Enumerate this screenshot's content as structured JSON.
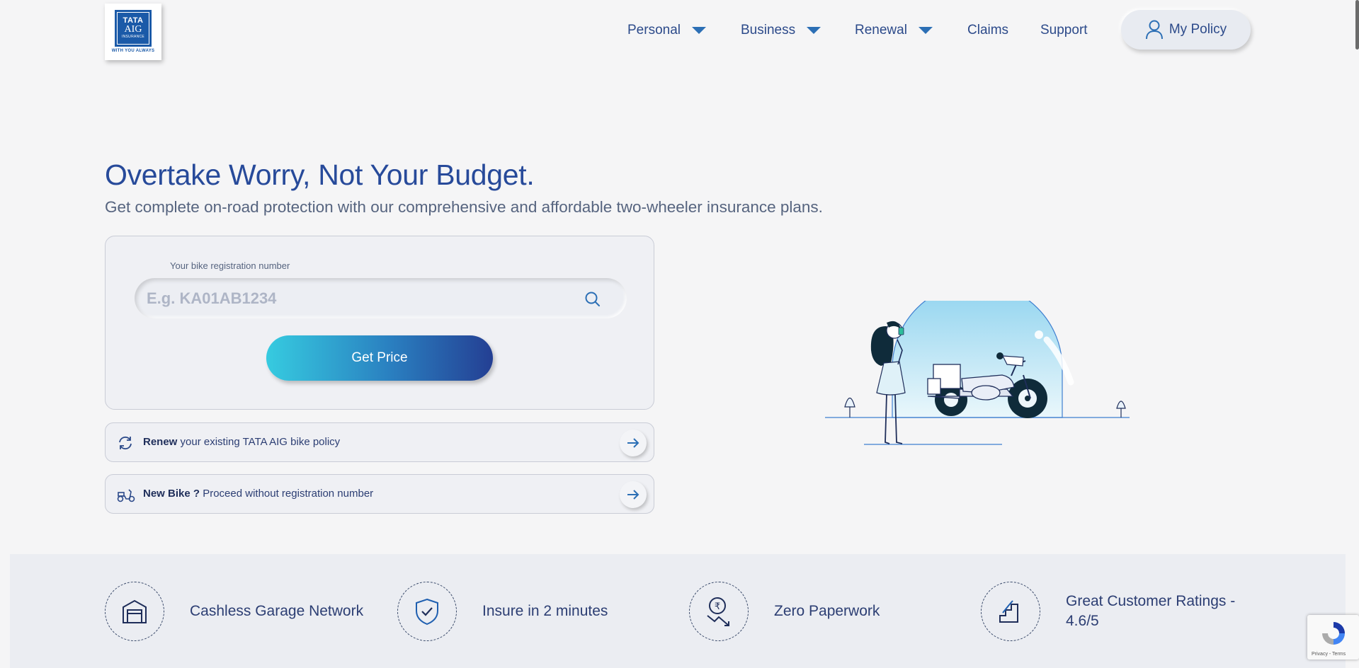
{
  "brand": {
    "logo_line1": "TATA",
    "logo_line2": "AIG",
    "logo_line3": "INSURANCE",
    "tagline": "WITH YOU ALWAYS"
  },
  "nav": {
    "items": [
      {
        "label": "Personal",
        "has_dropdown": true
      },
      {
        "label": "Business",
        "has_dropdown": true
      },
      {
        "label": "Renewal",
        "has_dropdown": true
      },
      {
        "label": "Claims",
        "has_dropdown": false
      },
      {
        "label": "Support",
        "has_dropdown": false
      }
    ],
    "policy_button": "My Policy"
  },
  "hero": {
    "title": "Overtake Worry, Not Your Budget.",
    "subtitle": "Get complete on-road protection with our comprehensive and affordable two-wheeler insurance plans."
  },
  "quote_form": {
    "field_label": "Your bike registration number",
    "placeholder": "E.g. KA01AB1234",
    "value": "",
    "submit_label": "Get Price"
  },
  "links": [
    {
      "bold": "Renew",
      "text": " your existing TATA AIG bike policy",
      "icon": "renew-icon"
    },
    {
      "bold": "New Bike ?",
      "text": " Proceed without registration number",
      "icon": "scooter-icon"
    }
  ],
  "features": [
    {
      "label": "Cashless Garage Network",
      "icon": "garage-icon"
    },
    {
      "label": "Insure in 2 minutes",
      "icon": "shield-check-icon"
    },
    {
      "label": "Zero Paperwork",
      "icon": "rupee-down-icon"
    },
    {
      "label": "Great Customer Ratings - 4.6/5",
      "icon": "stairs-icon"
    }
  ],
  "recaptcha": {
    "text": "Privacy - Terms"
  },
  "colors": {
    "primary": "#274a9a",
    "accent_start": "#36cbe0",
    "accent_end": "#243f93",
    "background": "#f5f5f6"
  }
}
